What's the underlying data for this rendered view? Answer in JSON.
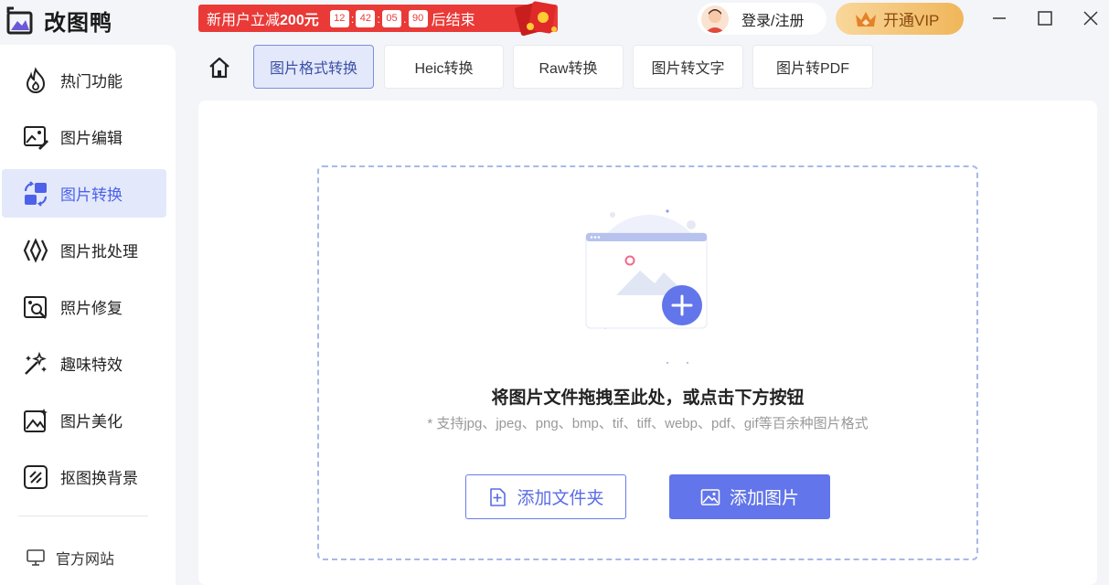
{
  "app": {
    "title": "改图鸭"
  },
  "promo": {
    "text_prefix": "新用户立减",
    "amount": "200元",
    "countdown": [
      "12",
      "42",
      "05",
      "90"
    ],
    "suffix": "后结束"
  },
  "header": {
    "login_label": "登录/注册",
    "vip_label": "开通VIP",
    "accent": "#e93a37",
    "vip_color": "#f0b65a"
  },
  "sidebar": {
    "items": [
      {
        "label": "热门功能",
        "icon": "fire-icon"
      },
      {
        "label": "图片编辑",
        "icon": "image-edit-icon"
      },
      {
        "label": "图片转换",
        "icon": "convert-icon",
        "active": true
      },
      {
        "label": "图片批处理",
        "icon": "batch-icon"
      },
      {
        "label": "照片修复",
        "icon": "photo-repair-icon"
      },
      {
        "label": "趣味特效",
        "icon": "magic-wand-icon"
      },
      {
        "label": "图片美化",
        "icon": "beautify-icon"
      },
      {
        "label": "抠图换背景",
        "icon": "cutout-icon"
      }
    ],
    "footer_label": "官方网站",
    "active_color": "#4d62e9"
  },
  "tabs": [
    {
      "label": "图片格式转换",
      "active": true
    },
    {
      "label": "Heic转换"
    },
    {
      "label": "Raw转换"
    },
    {
      "label": "图片转文字"
    },
    {
      "label": "图片转PDF"
    }
  ],
  "dropzone": {
    "title": "将图片文件拖拽至此处，或点击下方按钮",
    "subtitle": "* 支持jpg、jpeg、png、bmp、tif、tiff、webp、pdf、gif等百余种图片格式",
    "add_folder_label": "添加文件夹",
    "add_image_label": "添加图片",
    "primary_color": "#6275ea"
  }
}
